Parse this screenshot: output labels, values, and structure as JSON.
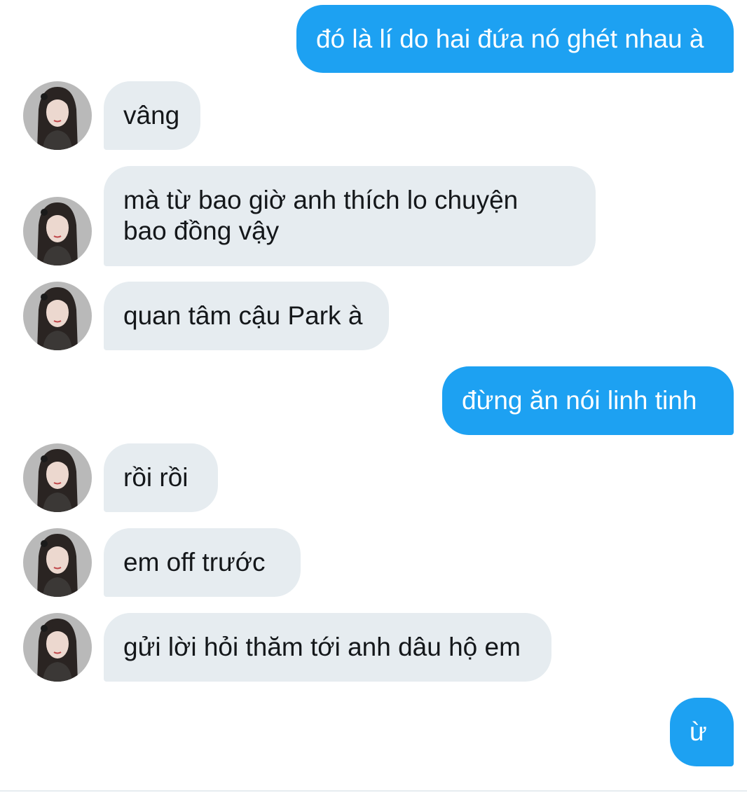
{
  "conversation": {
    "messages": [
      {
        "direction": "sent",
        "text": "đó là lí do hai đứa nó ghét nhau à"
      },
      {
        "direction": "received",
        "text": "vâng"
      },
      {
        "direction": "received",
        "text": "mà từ bao giờ anh thích lo chuyện\nbao đồng vậy"
      },
      {
        "direction": "received",
        "text": "quan tâm cậu Park à"
      },
      {
        "direction": "sent",
        "text": "đừng ăn nói linh tinh"
      },
      {
        "direction": "received",
        "text": "rồi rồi"
      },
      {
        "direction": "received",
        "text": "em off trước"
      },
      {
        "direction": "received",
        "text": "gửi lời hỏi thăm tới anh dâu hộ em"
      },
      {
        "direction": "sent",
        "text": "ừ"
      }
    ]
  },
  "colors": {
    "sent_bubble": "#1da1f2",
    "received_bubble": "#e6ecf0",
    "received_text": "#14171a",
    "sent_text": "#ffffff"
  },
  "icons": {
    "avatar": "contact-avatar-photo"
  }
}
